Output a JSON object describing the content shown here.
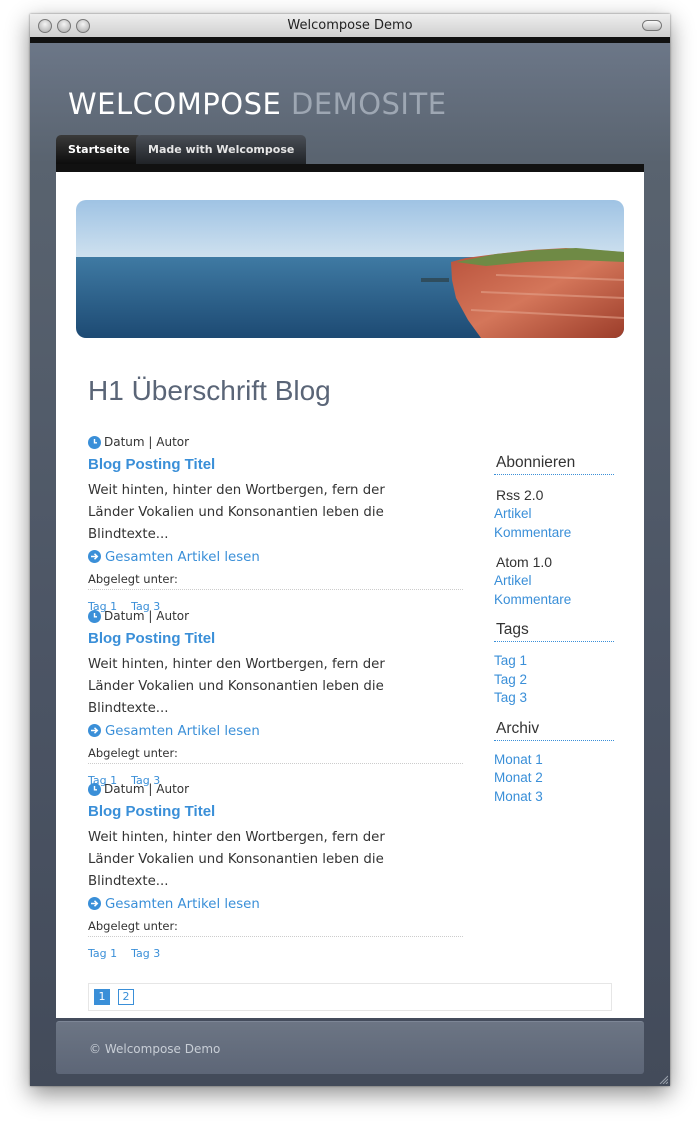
{
  "window": {
    "title": "Welcompose Demo"
  },
  "site": {
    "logo_main": "WELCOMPOSE",
    "logo_sub": "DEMOSITE"
  },
  "nav": {
    "tabs": [
      {
        "label": "Startseite"
      },
      {
        "label": "Made with Welcompose"
      }
    ]
  },
  "main": {
    "heading": "H1 Überschrift Blog",
    "posts": [
      {
        "meta": "Datum | Autor",
        "title": "Blog Posting Titel",
        "excerpt": "Weit hinten, hinter den Wortbergen, fern der Länder Vokalien und Konsonantien leben die Blindtexte...",
        "read_more": "Gesamten Artikel lesen",
        "filed": "Abgelegt unter:",
        "tags": [
          "Tag 1",
          "Tag 3"
        ]
      },
      {
        "meta": "Datum | Autor",
        "title": "Blog Posting Titel",
        "excerpt": "Weit hinten, hinter den Wortbergen, fern der Länder Vokalien und Konsonantien leben die Blindtexte...",
        "read_more": "Gesamten Artikel lesen",
        "filed": "Abgelegt unter:",
        "tags": [
          "Tag 1",
          "Tag 3"
        ]
      },
      {
        "meta": "Datum | Autor",
        "title": "Blog Posting Titel",
        "excerpt": "Weit hinten, hinter den Wortbergen, fern der Länder Vokalien und Konsonantien leben die Blindtexte...",
        "read_more": "Gesamten Artikel lesen",
        "filed": "Abgelegt unter:",
        "tags": [
          "Tag 1",
          "Tag 3"
        ]
      }
    ],
    "pagination": {
      "pages": [
        "1",
        "2"
      ],
      "current": "1"
    }
  },
  "sidebar": {
    "subscribe": {
      "heading": "Abonnieren",
      "rss": {
        "label": "Rss 2.0",
        "links": [
          "Artikel",
          "Kommentare"
        ]
      },
      "atom": {
        "label": "Atom 1.0",
        "links": [
          "Artikel",
          "Kommentare"
        ]
      }
    },
    "tags": {
      "heading": "Tags",
      "items": [
        "Tag 1",
        "Tag 2",
        "Tag 3"
      ]
    },
    "archive": {
      "heading": "Archiv",
      "items": [
        "Monat 1",
        "Monat 2",
        "Monat 3"
      ]
    }
  },
  "footer": {
    "text": "© Welcompose Demo"
  },
  "colors": {
    "link": "#3a8fd8",
    "page_bg": "#4e5868",
    "heading": "#5a6577"
  }
}
